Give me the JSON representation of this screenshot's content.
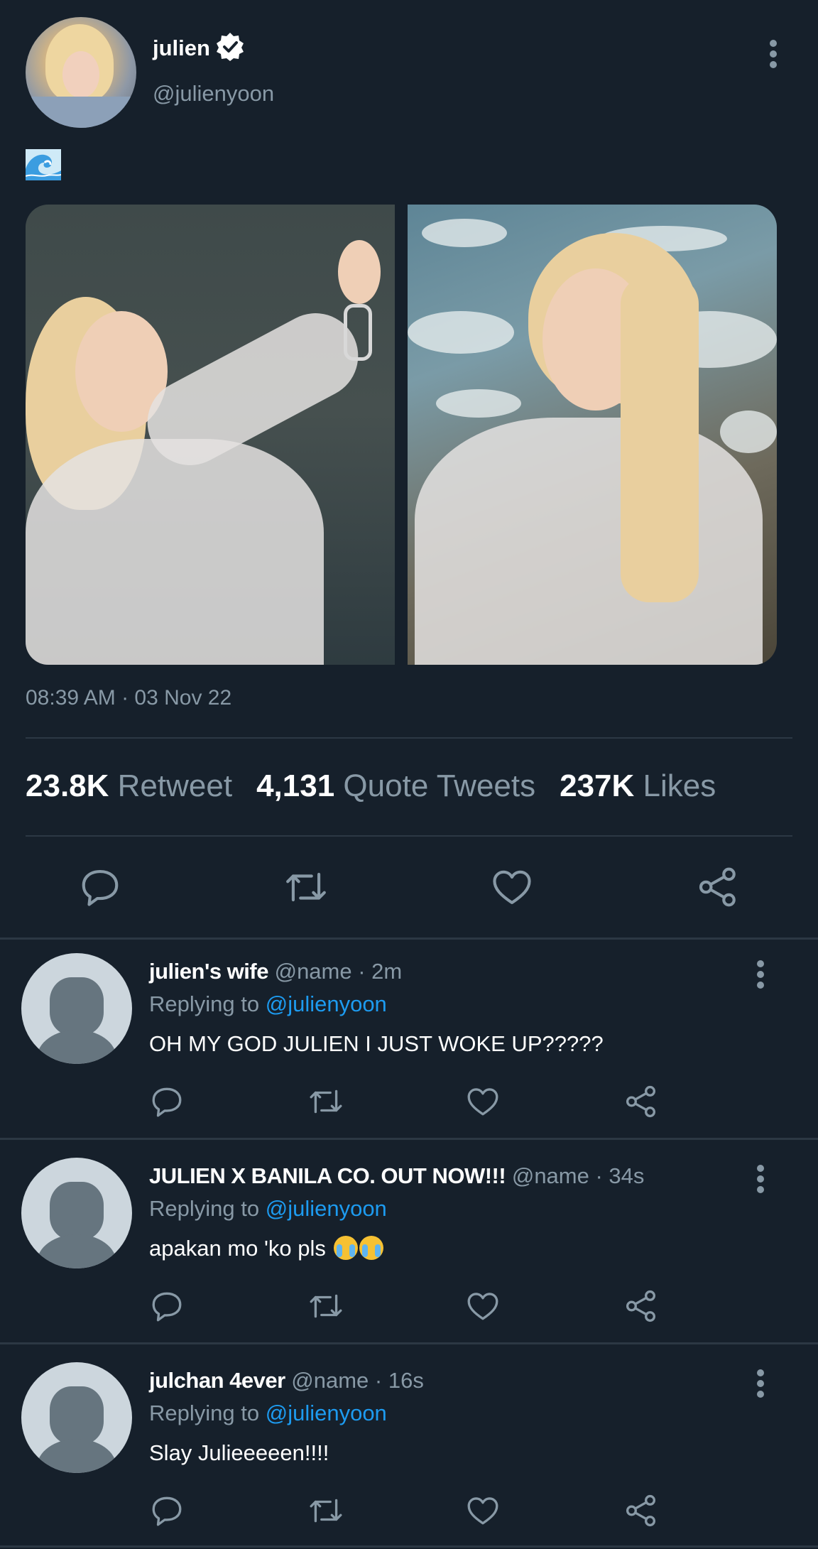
{
  "tweet": {
    "author_name": "julien",
    "author_handle": "@julienyoon",
    "verified": true,
    "text_emoji": "water-wave",
    "timestamp": "08:39 AM · 03 Nov 22",
    "media_count": 2
  },
  "stats": {
    "retweets_count": "23.8K",
    "retweets_label": "Retweet",
    "quotes_count": "4,131",
    "quotes_label": "Quote Tweets",
    "likes_count": "237K",
    "likes_label": "Likes"
  },
  "actions": [
    "reply-icon",
    "retweet-icon",
    "like-icon",
    "share-icon"
  ],
  "replies": [
    {
      "name": "julien's wife",
      "meta": "@name · 2m",
      "replying_prefix": "Replying to ",
      "replying_to": "@julienyoon",
      "text": "OH MY GOD JULIEN I JUST WOKE UP?????"
    },
    {
      "name": "JULIEN X BANILA CO. OUT NOW!!!",
      "meta": "@name · 34s",
      "replying_prefix": "Replying to ",
      "replying_to": "@julienyoon",
      "text": "apakan mo 'ko pls",
      "text_emojis": [
        "loudly-crying-face",
        "loudly-crying-face"
      ]
    },
    {
      "name": "julchan 4ever",
      "meta": "@name · 16s",
      "replying_prefix": "Replying to ",
      "replying_to": "@julienyoon",
      "text": "Slay Julieeeeen!!!!"
    }
  ],
  "colors": {
    "background": "#16202b",
    "secondary_text": "#8899a6",
    "link": "#1d9bf0",
    "divider": "#2c3844"
  }
}
